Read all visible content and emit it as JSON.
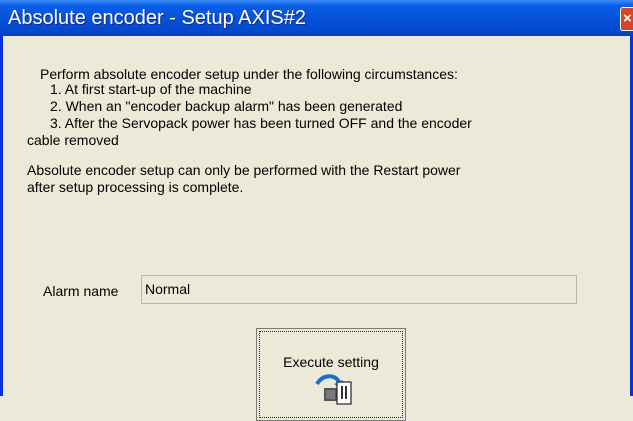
{
  "window": {
    "title": "Absolute encoder - Setup AXIS#2",
    "close_label": "×"
  },
  "instructions": {
    "intro": "Perform absolute encoder setup under the following circumstances:",
    "item1": "1. At first start-up of the machine",
    "item2": "2. When an \"encoder backup alarm\" has been generated",
    "item3_line1": "3. After the Servopack power has been turned OFF and the encoder",
    "item3_line2": "cable removed",
    "note_line1": "Absolute encoder setup can only be performed with the Restart power",
    "note_line2": "after setup processing is complete."
  },
  "alarm": {
    "label": "Alarm name",
    "value": "Normal"
  },
  "execute_button": {
    "label": "Execute setting",
    "icon": "encoder-setup-icon"
  }
}
